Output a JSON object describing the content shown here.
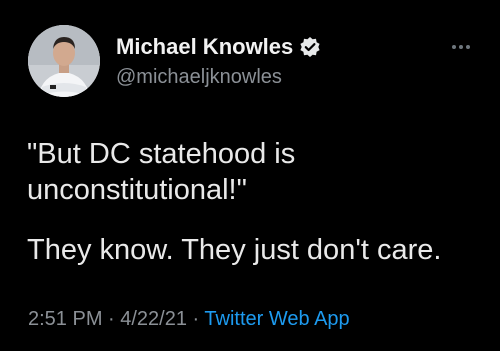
{
  "author": {
    "display_name": "Michael Knowles",
    "handle": "@michaeljknowles",
    "verified": true,
    "avatar_icon": "profile-photo"
  },
  "tweet": {
    "quote_text": "\"But DC statehood is\nunconstitutional!\"",
    "body_text": "They know. They just don't care."
  },
  "meta": {
    "timestamp": "2:51 PM · 4/22/21",
    "separator": " · ",
    "source": "Twitter Web App"
  },
  "menu": {
    "icon": "more-options-icon"
  },
  "colors": {
    "background": "#000000",
    "text_primary": "#e7e9ea",
    "text_secondary": "#8b9096",
    "link": "#1d9bf0",
    "verified_badge": "#e7e9ea"
  }
}
